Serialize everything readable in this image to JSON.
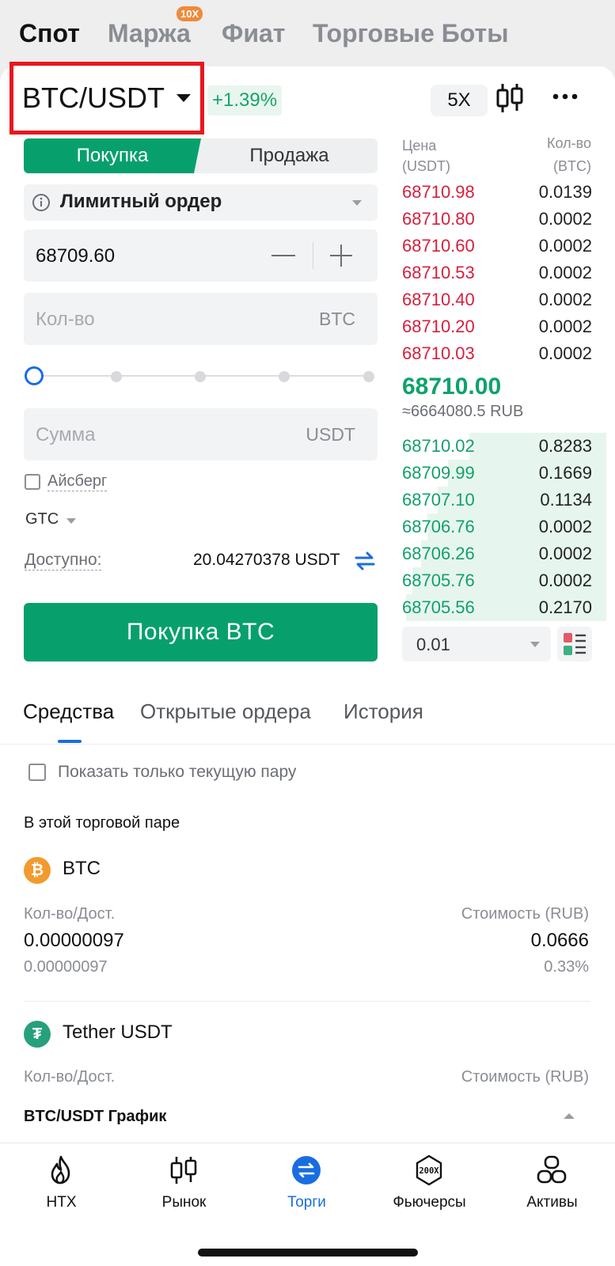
{
  "top_tabs": {
    "spot": "Спот",
    "margin": "Маржа",
    "margin_badge": "10X",
    "fiat": "Фиат",
    "bots": "Торговые Боты"
  },
  "pair": {
    "name": "BTC/USDT",
    "change": "+1.39%",
    "leverage": "5X"
  },
  "order_form": {
    "buy_label": "Покупка",
    "sell_label": "Продажа",
    "order_type": "Лимитный ордер",
    "price_value": "68709.60",
    "qty_placeholder": "Кол-во",
    "qty_unit": "BTC",
    "amount_placeholder": "Сумма",
    "amount_unit": "USDT",
    "iceberg_label": "Айсберг",
    "tif": "GTC",
    "available_label": "Доступно:",
    "available_value": "20.04270378 USDT",
    "submit_label": "Покупка  BTC"
  },
  "order_book": {
    "price_header_1": "Цена",
    "price_header_2": "(USDT)",
    "qty_header_1": "Кол-во",
    "qty_header_2": "(BTC)",
    "asks": [
      {
        "price": "68710.98",
        "qty": "0.0139"
      },
      {
        "price": "68710.80",
        "qty": "0.0002"
      },
      {
        "price": "68710.60",
        "qty": "0.0002"
      },
      {
        "price": "68710.53",
        "qty": "0.0002"
      },
      {
        "price": "68710.40",
        "qty": "0.0002"
      },
      {
        "price": "68710.20",
        "qty": "0.0002"
      },
      {
        "price": "68710.03",
        "qty": "0.0002"
      }
    ],
    "last_price": "68710.00",
    "last_price_rub": "≈6664080.5 RUB",
    "bids": [
      {
        "price": "68710.02",
        "qty": "0.8283",
        "depth": 0.65
      },
      {
        "price": "68709.99",
        "qty": "0.1669",
        "depth": 0.75
      },
      {
        "price": "68707.10",
        "qty": "0.1134",
        "depth": 0.8
      },
      {
        "price": "68706.76",
        "qty": "0.0002",
        "depth": 0.85
      },
      {
        "price": "68706.26",
        "qty": "0.0002",
        "depth": 0.88
      },
      {
        "price": "68705.76",
        "qty": "0.0002",
        "depth": 0.92
      },
      {
        "price": "68705.56",
        "qty": "0.2170",
        "depth": 0.95
      }
    ],
    "precision": "0.01"
  },
  "section_tabs": {
    "assets": "Средства",
    "open_orders": "Открытые ордера",
    "history": "История"
  },
  "assets": {
    "show_current_pair": "Показать только текущую пару",
    "in_pair_title": "В этой торговой паре",
    "coins": [
      {
        "symbol": "BTC",
        "qty_label": "Кол-во/Дост.",
        "value_label": "Стоимость (RUB)",
        "qty": "0.00000097",
        "available": "0.00000097",
        "value": "0.0666",
        "percent": "0.33%"
      },
      {
        "symbol": "Tether USDT",
        "qty_label": "Кол-во/Дост.",
        "value_label": "Стоимость (RUB)"
      }
    ]
  },
  "chart_bar": {
    "label": "BTC/USDT График"
  },
  "nav": {
    "items": [
      {
        "label": "HTX",
        "icon": "flame-icon"
      },
      {
        "label": "Рынок",
        "icon": "candlestick-icon"
      },
      {
        "label": "Торги",
        "icon": "trade-icon"
      },
      {
        "label": "Фьючерсы",
        "icon": "futures-200x-icon"
      },
      {
        "label": "Активы",
        "icon": "assets-icon"
      }
    ]
  },
  "colors": {
    "buy_green": "#07a06c",
    "ask_red": "#d61f3e",
    "accent_blue": "#1a6de0",
    "highlight_red": "#e8181e"
  }
}
